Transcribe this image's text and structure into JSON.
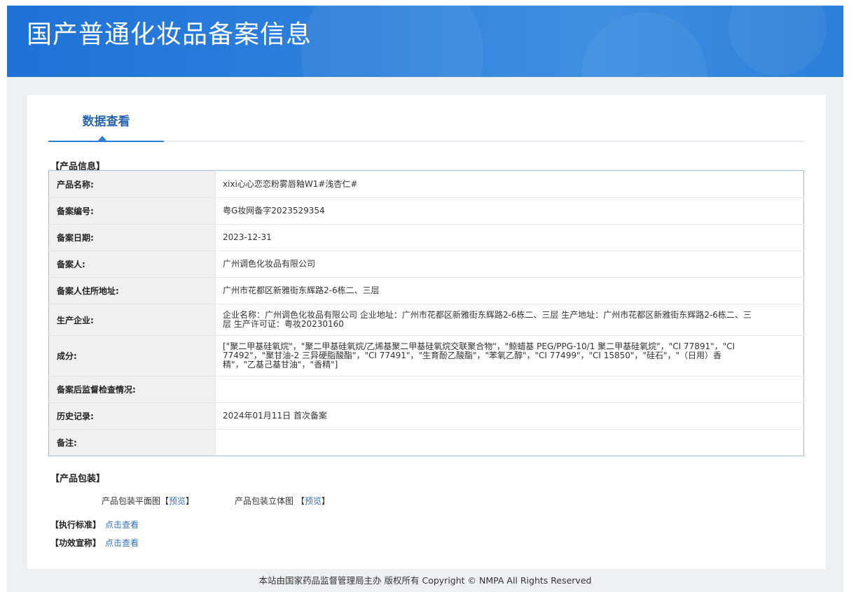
{
  "header": {
    "title": "国产普通化妆品备案信息"
  },
  "tabs": [
    {
      "label": "数据查看"
    }
  ],
  "product_info": {
    "section_title": "【产品信息】",
    "rows": [
      {
        "label": "产品名称:",
        "value": "xixi心心恋恋粉雾唇釉W1#浅杏仁#"
      },
      {
        "label": "备案编号:",
        "value": "粤G妆网备字2023529354"
      },
      {
        "label": "备案日期:",
        "value": "2023-12-31"
      },
      {
        "label": "备案人:",
        "value": "广州调色化妆品有限公司"
      },
      {
        "label": "备案人住所地址:",
        "value": "广州市花都区新雅街东辉路2-6栋二、三层"
      },
      {
        "label": "生产企业:",
        "value": "企业名称：广州调色化妆品有限公司 企业地址：广州市花都区新雅街东辉路2-6栋二、三层 生产地址：广州市花都区新雅街东辉路2-6栋二、三层 生产许可证：粤妆20230160"
      },
      {
        "label": "成分:",
        "value": "[\"聚二甲基硅氧烷\"，\"聚二甲基硅氧烷/乙烯基聚二甲基硅氧烷交联聚合物\"，\"鲸蜡基 PEG/PPG-10/1 聚二甲基硅氧烷\"，\"CI 77891\"，\"CI 77492\"，\"聚甘油-2 三异硬脂酸酯\"，\"CI 77491\"，\"生育酚乙酸酯\"，\"苯氧乙醇\"，\"CI 77499\"，\"CI 15850\"，\"硅石\"，\"（日用）香精\"，\"乙基己基甘油\"，\"香精\"]"
      },
      {
        "label": "备案后监督检查情况:",
        "value": ""
      },
      {
        "label": "历史记录:",
        "value": "2024年01月11日 首次备案"
      },
      {
        "label": "备注:",
        "value": ""
      }
    ]
  },
  "packaging": {
    "section_title": "【产品包装】",
    "items": [
      {
        "label": "产品包装平面图",
        "bracket_open": "【",
        "link": "预览",
        "bracket_close": "】"
      },
      {
        "label": "产品包装立体图 ",
        "bracket_open": "【",
        "link": "预览",
        "bracket_close": "】"
      }
    ]
  },
  "standard": {
    "label": "【执行标准】",
    "link": "点击查看"
  },
  "efficacy": {
    "label": "【功效宣称】",
    "link": "点击查看"
  },
  "footer": {
    "text": "本站由国家药品监督管理局主办 版权所有 Copyright © NMPA All Rights Reserved"
  },
  "colors": {
    "banner": "#2e80dc",
    "accent": "#2a66ad",
    "link": "#2f73c0",
    "table_border": "#9cc0e2"
  }
}
